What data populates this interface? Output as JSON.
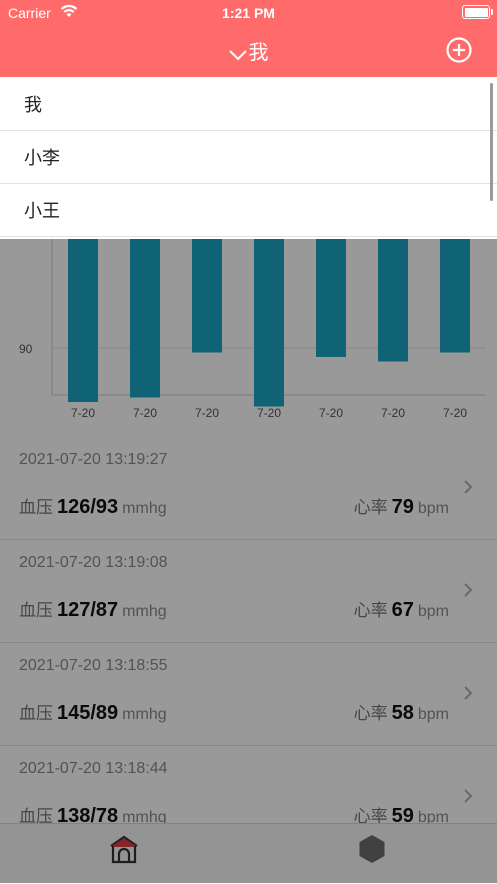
{
  "status_bar": {
    "carrier": "Carrier",
    "time": "1:21 PM"
  },
  "nav": {
    "title": "我",
    "add_icon": "plus-circle-icon"
  },
  "colors": {
    "header": "#ff6b6b",
    "bar": "#1aa6c2"
  },
  "chart_data": {
    "type": "bar",
    "categories": [
      "7-20",
      "7-20",
      "7-20",
      "7-20",
      "7-20",
      "7-20",
      "7-20"
    ],
    "ytick_label": "90",
    "ytick_value": 90,
    "series": [
      {
        "low": [
          78,
          79,
          89,
          77,
          88,
          87,
          89
        ],
        "high": [
          145,
          138,
          145,
          138,
          145,
          145,
          145
        ]
      }
    ]
  },
  "records": [
    {
      "time": "2021-07-20 13:19:27",
      "bp_label": "血压",
      "bp": "126/93",
      "bp_unit": "mmhg",
      "hr_label": "心率",
      "hr": "79",
      "hr_unit": "bpm"
    },
    {
      "time": "2021-07-20 13:19:08",
      "bp_label": "血压",
      "bp": "127/87",
      "bp_unit": "mmhg",
      "hr_label": "心率",
      "hr": "67",
      "hr_unit": "bpm"
    },
    {
      "time": "2021-07-20 13:18:55",
      "bp_label": "血压",
      "bp": "145/89",
      "bp_unit": "mmhg",
      "hr_label": "心率",
      "hr": "58",
      "hr_unit": "bpm"
    },
    {
      "time": "2021-07-20 13:18:44",
      "bp_label": "血压",
      "bp": "138/78",
      "bp_unit": "mmhg",
      "hr_label": "心率",
      "hr": "59",
      "hr_unit": "bpm"
    }
  ],
  "dropdown": {
    "items": [
      "我",
      "小李",
      "小王"
    ]
  },
  "tabbar": {
    "home_icon": "home-icon",
    "second_icon": "hexagon-icon"
  }
}
